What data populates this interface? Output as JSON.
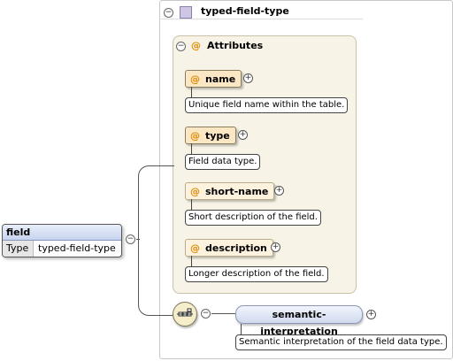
{
  "complex_type": {
    "name": "typed-field-type",
    "expand": "⊖"
  },
  "attributes_group": {
    "title": "Attributes",
    "symbol": "@"
  },
  "attributes": [
    {
      "name": "name",
      "doc": "Unique field name within the table."
    },
    {
      "name": "type",
      "doc": "Field data type."
    },
    {
      "name": "short-name",
      "doc": "Short description of the field."
    },
    {
      "name": "description",
      "doc": "Longer description of the field."
    }
  ],
  "element": {
    "name": "field",
    "type_key": "Type",
    "type_value": "typed-field-type"
  },
  "child_element": {
    "name": "semantic-interpretation",
    "doc": "Semantic interpretation of the field data type."
  },
  "colors": {
    "attribute_fill": "#fbe7c3",
    "attribute_symbol": "#e08a00",
    "element_fill": "#c7d4ee"
  }
}
